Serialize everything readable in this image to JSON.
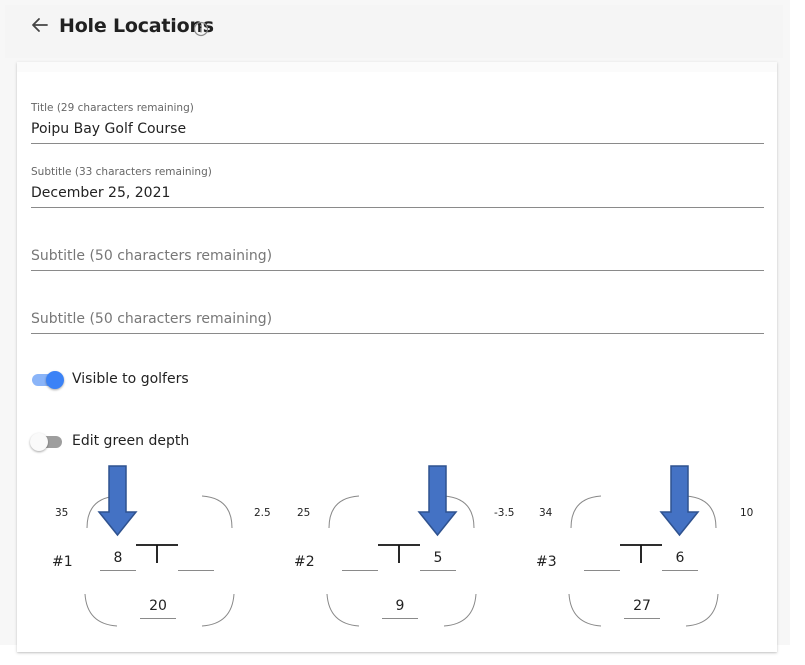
{
  "header": {
    "title": "Hole Locations",
    "back_icon": "arrow-left-icon",
    "info_icon": "info-icon"
  },
  "form": {
    "title_field": {
      "label": "Title (29 characters remaining)",
      "value": "Poipu Bay Golf Course"
    },
    "subtitle_field_1": {
      "label": "Subtitle (33 characters remaining)",
      "value": "December 25, 2021"
    },
    "subtitle_field_2": {
      "placeholder": "Subtitle (50 characters remaining)",
      "value": ""
    },
    "subtitle_field_3": {
      "placeholder": "Subtitle (50 characters remaining)",
      "value": ""
    }
  },
  "toggles": {
    "visible": {
      "label": "Visible to golfers",
      "on": true
    },
    "edit_depth": {
      "label": "Edit green depth",
      "on": false
    }
  },
  "holes": [
    {
      "number": "#1",
      "top_left": "35",
      "top_right": "2.5",
      "left_value": "8",
      "right_value": "",
      "bottom_value": "20"
    },
    {
      "number": "#2",
      "top_left": "25",
      "top_right": "-3.5",
      "left_value": "",
      "right_value": "5",
      "bottom_value": "9"
    },
    {
      "number": "#3",
      "top_left": "34",
      "top_right": "10",
      "left_value": "",
      "right_value": "6",
      "bottom_value": "27"
    }
  ],
  "colors": {
    "accent": "#3b82f6",
    "arrow_fill": "#4472c4",
    "arrow_stroke": "#2f528f"
  }
}
